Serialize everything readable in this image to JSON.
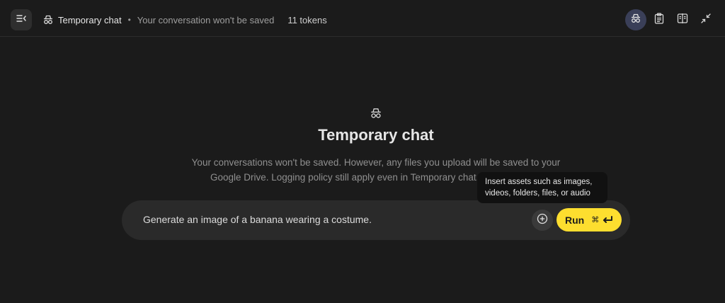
{
  "header": {
    "title": "Temporary chat",
    "separator": "•",
    "subtitle": "Your conversation won't be saved",
    "tokens": "11 tokens"
  },
  "main": {
    "title": "Temporary chat",
    "description": "Your conversations won't be saved. However, any files you upload will be saved to your Google Drive. Logging policy still apply even in Temporary chat. See the policy"
  },
  "composer": {
    "prompt": "Generate an image of a banana wearing a costume.",
    "run_label": "Run",
    "shortcut": "⌘"
  },
  "tooltip": {
    "text": "Insert assets such as images, videos, folders, files, or audio"
  },
  "icons": {
    "menu": "sidebar-toggle-icon",
    "incognito": "incognito-icon",
    "clipboard": "clipboard-icon",
    "compare": "compare-icon",
    "collapse": "collapse-icon",
    "add": "plus-circle-icon",
    "enter": "enter-icon"
  },
  "colors": {
    "background": "#1b1b1b",
    "run_button": "#fdde2f",
    "active_icon_bg": "#3a3f58"
  }
}
